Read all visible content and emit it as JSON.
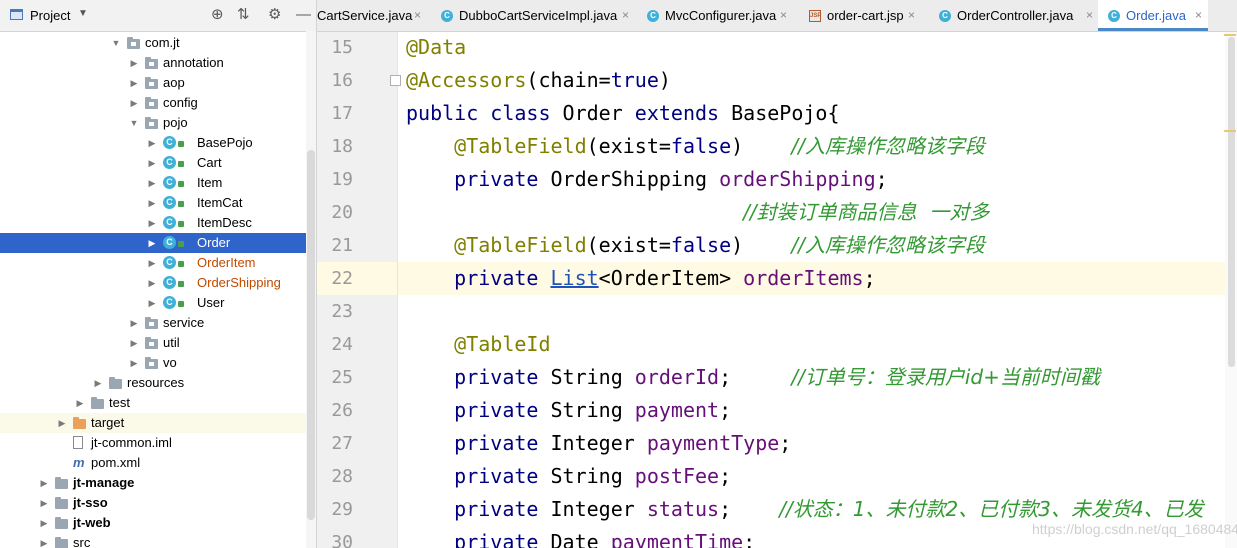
{
  "project_panel": {
    "title": "Project",
    "tree": [
      {
        "label": "com.jt",
        "indent": 2,
        "arrow": "▼",
        "icon": "package"
      },
      {
        "label": "annotation",
        "indent": 3,
        "arrow": "▶",
        "icon": "package"
      },
      {
        "label": "aop",
        "indent": 3,
        "arrow": "▶",
        "icon": "package"
      },
      {
        "label": "config",
        "indent": 3,
        "arrow": "▶",
        "icon": "package"
      },
      {
        "label": "pojo",
        "indent": 3,
        "arrow": "▼",
        "icon": "package"
      },
      {
        "label": "BasePojo",
        "indent": 4,
        "arrow": "▶",
        "icon": "class"
      },
      {
        "label": "Cart",
        "indent": 4,
        "arrow": "▶",
        "icon": "class"
      },
      {
        "label": "Item",
        "indent": 4,
        "arrow": "▶",
        "icon": "class"
      },
      {
        "label": "ItemCat",
        "indent": 4,
        "arrow": "▶",
        "icon": "class"
      },
      {
        "label": "ItemDesc",
        "indent": 4,
        "arrow": "▶",
        "icon": "class"
      },
      {
        "label": "Order",
        "indent": 4,
        "arrow": "▶",
        "icon": "class",
        "selected": true
      },
      {
        "label": "OrderItem",
        "indent": 4,
        "arrow": "▶",
        "icon": "class",
        "modified": true
      },
      {
        "label": "OrderShipping",
        "indent": 4,
        "arrow": "▶",
        "icon": "class",
        "modified": true
      },
      {
        "label": "User",
        "indent": 4,
        "arrow": "▶",
        "icon": "class"
      },
      {
        "label": "service",
        "indent": 3,
        "arrow": "▶",
        "icon": "package"
      },
      {
        "label": "util",
        "indent": 3,
        "arrow": "▶",
        "icon": "package"
      },
      {
        "label": "vo",
        "indent": 3,
        "arrow": "▶",
        "icon": "package"
      },
      {
        "label": "resources",
        "indent": 1,
        "arrow": "▶",
        "icon": "res-folder"
      },
      {
        "label": "test",
        "indent": 0,
        "arrow": "▶",
        "icon": "folder"
      },
      {
        "label": "target",
        "indent": -1,
        "arrow": "▶",
        "icon": "orange-folder",
        "highlight": true
      },
      {
        "label": "jt-common.iml",
        "indent": -1,
        "arrow": "",
        "icon": "file"
      },
      {
        "label": "pom.xml",
        "indent": -1,
        "arrow": "",
        "icon": "maven"
      },
      {
        "label": "jt-manage",
        "indent": -2,
        "arrow": "▶",
        "icon": "module",
        "bold": true
      },
      {
        "label": "jt-sso",
        "indent": -2,
        "arrow": "▶",
        "icon": "module",
        "bold": true
      },
      {
        "label": "jt-web",
        "indent": -2,
        "arrow": "▶",
        "icon": "module",
        "bold": true
      },
      {
        "label": "src",
        "indent": -2,
        "arrow": "▶",
        "icon": "folder"
      }
    ]
  },
  "tabs": [
    {
      "label": "CartService.java",
      "icon": "class"
    },
    {
      "label": "DubboCartServiceImpl.java",
      "icon": "class"
    },
    {
      "label": "MvcConfigurer.java",
      "icon": "class"
    },
    {
      "label": "order-cart.jsp",
      "icon": "jsp"
    },
    {
      "label": "OrderController.java",
      "icon": "class"
    },
    {
      "label": "Order.java",
      "icon": "class",
      "active": true
    }
  ],
  "editor": {
    "lines": [
      {
        "n": "15",
        "code": [
          [
            "an",
            "@Data"
          ]
        ]
      },
      {
        "n": "16",
        "code": [
          [
            "an",
            "@Accessors"
          ],
          [
            "",
            "(chain="
          ],
          [
            "kw",
            "true"
          ],
          [
            "",
            ")"
          ]
        ]
      },
      {
        "n": "17",
        "code": [
          [
            "kw",
            "public class "
          ],
          [
            "",
            "Order "
          ],
          [
            "kw",
            "extends "
          ],
          [
            "",
            "BasePojo{"
          ]
        ]
      },
      {
        "n": "18",
        "code": [
          [
            "",
            "    "
          ],
          [
            "an",
            "@TableField"
          ],
          [
            "",
            "(exist="
          ],
          [
            "kw",
            "false"
          ],
          [
            "",
            ")    "
          ],
          [
            "cmt",
            "//入库操作忽略该字段"
          ]
        ]
      },
      {
        "n": "19",
        "code": [
          [
            "",
            "    "
          ],
          [
            "kw",
            "private "
          ],
          [
            "",
            "OrderShipping "
          ],
          [
            "fld",
            "orderShipping"
          ],
          [
            "",
            ";"
          ]
        ]
      },
      {
        "n": "20",
        "code": [
          [
            "",
            "                            "
          ],
          [
            "cmt",
            "//封装订单商品信息  一对多"
          ]
        ]
      },
      {
        "n": "21",
        "code": [
          [
            "",
            "    "
          ],
          [
            "an",
            "@TableField"
          ],
          [
            "",
            "(exist="
          ],
          [
            "kw",
            "false"
          ],
          [
            "",
            ")    "
          ],
          [
            "cmt",
            "//入库操作忽略该字段"
          ]
        ]
      },
      {
        "n": "22",
        "code": [
          [
            "",
            "    "
          ],
          [
            "kw",
            "private "
          ],
          [
            "lnk",
            "List"
          ],
          [
            "",
            "<OrderItem> "
          ],
          [
            "fld",
            "orderItems"
          ],
          [
            "",
            ";"
          ]
        ],
        "current": true
      },
      {
        "n": "23",
        "code": []
      },
      {
        "n": "24",
        "code": [
          [
            "",
            "    "
          ],
          [
            "an",
            "@TableId"
          ]
        ]
      },
      {
        "n": "25",
        "code": [
          [
            "",
            "    "
          ],
          [
            "kw",
            "private "
          ],
          [
            "",
            "String "
          ],
          [
            "fld",
            "orderId"
          ],
          [
            "",
            ";     "
          ],
          [
            "cmt",
            "//订单号：登录用户id+当前时间戳"
          ]
        ]
      },
      {
        "n": "26",
        "code": [
          [
            "",
            "    "
          ],
          [
            "kw",
            "private "
          ],
          [
            "",
            "String "
          ],
          [
            "fld",
            "payment"
          ],
          [
            "",
            ";"
          ]
        ]
      },
      {
        "n": "27",
        "code": [
          [
            "",
            "    "
          ],
          [
            "kw",
            "private "
          ],
          [
            "",
            "Integer "
          ],
          [
            "fld",
            "paymentType"
          ],
          [
            "",
            ";"
          ]
        ]
      },
      {
        "n": "28",
        "code": [
          [
            "",
            "    "
          ],
          [
            "kw",
            "private "
          ],
          [
            "",
            "String "
          ],
          [
            "fld",
            "postFee"
          ],
          [
            "",
            ";"
          ]
        ]
      },
      {
        "n": "29",
        "code": [
          [
            "",
            "    "
          ],
          [
            "kw",
            "private "
          ],
          [
            "",
            "Integer "
          ],
          [
            "fld",
            "status"
          ],
          [
            "",
            ";    "
          ],
          [
            "cmt",
            "//状态：1、未付款2、已付款3、未发货4、已发"
          ]
        ]
      },
      {
        "n": "30",
        "code": [
          [
            "",
            "    "
          ],
          [
            "kw",
            "private "
          ],
          [
            "",
            "Date "
          ],
          [
            "fld",
            "paymentTime"
          ],
          [
            "",
            ";"
          ]
        ]
      }
    ]
  },
  "watermark": "https://blog.csdn.net/qq_16804847"
}
